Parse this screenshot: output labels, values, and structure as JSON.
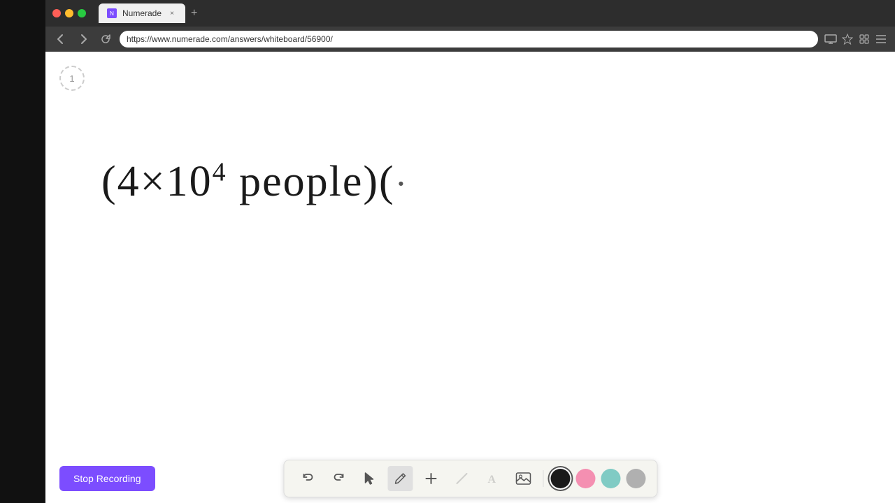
{
  "browser": {
    "tab_title": "Numerade",
    "tab_favicon": "N",
    "url": "https://www.numerade.com/answers/whiteboard/56900/",
    "controls": {
      "close": "×",
      "minimize": "−",
      "maximize": "+"
    },
    "nav": {
      "back": "←",
      "forward": "→",
      "refresh": "↻"
    }
  },
  "page": {
    "number": "1",
    "math_expression": "(4×10⁴ people)(",
    "math_parts": {
      "prefix": "(4×10",
      "exponent": "4",
      "suffix": " people)("
    }
  },
  "toolbar": {
    "undo_label": "↺",
    "redo_label": "↻",
    "select_label": "▶",
    "pen_label": "✏",
    "add_label": "+",
    "eraser_label": "/",
    "text_label": "A",
    "image_label": "🖼",
    "colors": [
      {
        "name": "black",
        "value": "#1a1a1a",
        "selected": true
      },
      {
        "name": "pink",
        "value": "#f48fb1",
        "selected": false
      },
      {
        "name": "green",
        "value": "#80cbc4",
        "selected": false
      },
      {
        "name": "gray",
        "value": "#b0b0b0",
        "selected": false
      }
    ]
  },
  "recording": {
    "stop_label": "Stop Recording",
    "btn_color": "#7c4dff"
  }
}
